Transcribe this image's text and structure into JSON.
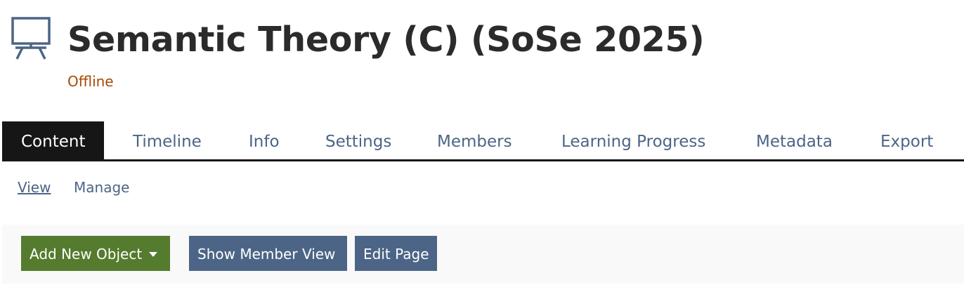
{
  "header": {
    "icon": "blackboard-easel-icon",
    "title": "Semantic Theory (C) (SoSe 2025)",
    "status": "Offline"
  },
  "tabs": [
    {
      "label": "Content",
      "active": true
    },
    {
      "label": "Timeline"
    },
    {
      "label": "Info"
    },
    {
      "label": "Settings"
    },
    {
      "label": "Members"
    },
    {
      "label": "Learning Progress"
    },
    {
      "label": "Metadata"
    },
    {
      "label": "Export"
    }
  ],
  "subtabs": [
    {
      "label": "View",
      "active": true
    },
    {
      "label": "Manage"
    }
  ],
  "toolbar": {
    "add_new_object": "Add New Object",
    "show_member_view": "Show Member View",
    "edit_page": "Edit Page"
  },
  "colors": {
    "tab_active_bg": "#161616",
    "link": "#4c6586",
    "status_offline": "#a74a06",
    "primary_button": "#557b2e",
    "default_button": "#4c6586"
  }
}
